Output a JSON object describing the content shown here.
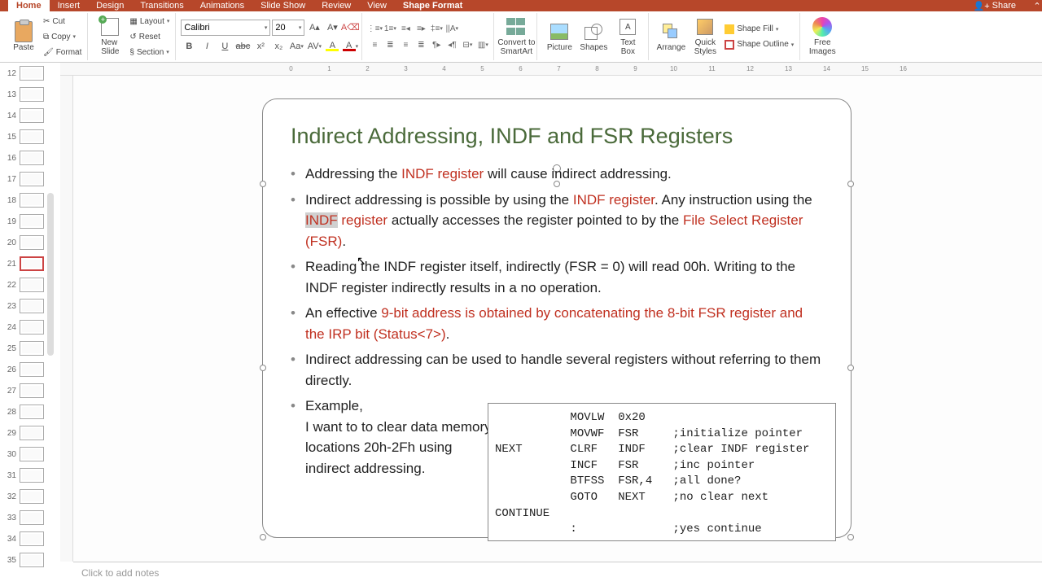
{
  "tabs": {
    "home": "Home",
    "insert": "Insert",
    "design": "Design",
    "transitions": "Transitions",
    "animations": "Animations",
    "slideshow": "Slide Show",
    "review": "Review",
    "view": "View",
    "shape_format": "Shape Format",
    "share": "Share"
  },
  "ribbon": {
    "paste": "Paste",
    "cut": "Cut",
    "copy": "Copy",
    "format": "Format",
    "new_slide": "New\nSlide",
    "layout": "Layout",
    "reset": "Reset",
    "section": "Section",
    "font_name": "Calibri",
    "font_size": "20",
    "convert_smartart": "Convert to\nSmartArt",
    "picture": "Picture",
    "shapes": "Shapes",
    "text_box": "Text\nBox",
    "arrange": "Arrange",
    "quick_styles": "Quick\nStyles",
    "shape_fill": "Shape Fill",
    "shape_outline": "Shape Outline",
    "free_images": "Free\nImages"
  },
  "thumbnails": [
    12,
    13,
    14,
    15,
    16,
    17,
    18,
    19,
    20,
    21,
    22,
    23,
    24,
    25,
    26,
    27,
    28,
    29,
    30,
    31,
    32,
    33,
    34,
    35
  ],
  "active_slide": 21,
  "slide": {
    "title": "Indirect Addressing, INDF and FSR Registers",
    "b1_a": "Addressing the ",
    "b1_red": "INDF register",
    "b1_b": " will cause indirect addressing.",
    "b2_a": "Indirect addressing is possible by using the ",
    "b2_red1": "INDF register",
    "b2_b": ". Any instruction using the ",
    "b2_sel": "INDF",
    "b2_red2": " register",
    "b2_c": " actually accesses the register pointed to by the ",
    "b2_red3": "File Select Register (FSR)",
    "b2_d": ".",
    "b3": "Reading the INDF register itself, indirectly (FSR = 0) will read 00h. Writing to the INDF register indirectly results in a no operation.",
    "b4_a": "An effective ",
    "b4_red": "9-bit address is obtained by concatenating the 8-bit FSR register and the IRP bit (Status<7>)",
    "b4_b": ".",
    "b5": "Indirect addressing can be used to handle several registers without referring to them directly.",
    "b6_a": "Example,",
    "b6_b": "I want to to clear data memory  locations 20h-2Fh using indirect addressing.",
    "code": "           MOVLW  0x20\n           MOVWF  FSR     ;initialize pointer\nNEXT       CLRF   INDF    ;clear INDF register\n           INCF   FSR     ;inc pointer\n           BTFSS  FSR,4   ;all done?\n           GOTO   NEXT    ;no clear next\nCONTINUE\n           :              ;yes continue"
  },
  "notes_placeholder": "Click to add notes"
}
